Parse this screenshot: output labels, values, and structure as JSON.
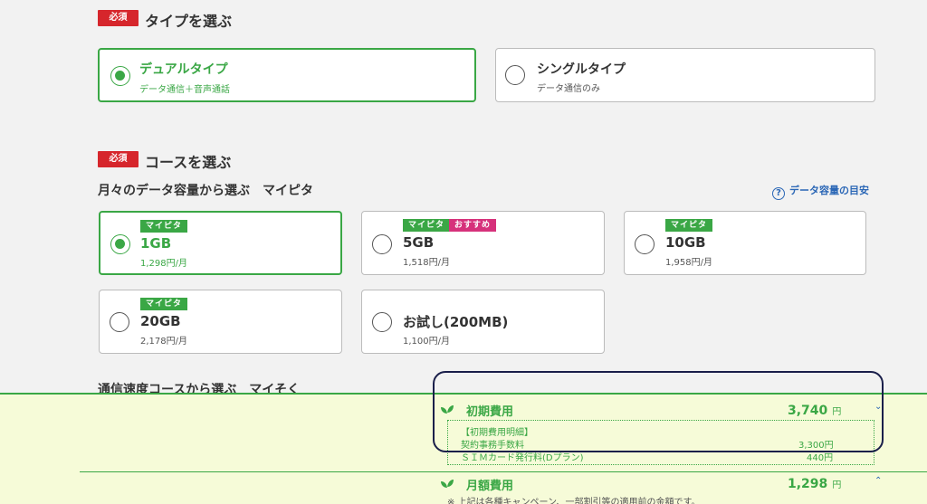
{
  "type_section": {
    "badge": "必須",
    "title": "タイプを選ぶ",
    "options": [
      {
        "name": "デュアルタイプ",
        "sub": "データ通信＋音声通話",
        "selected": true
      },
      {
        "name": "シングルタイプ",
        "sub": "データ通信のみ",
        "selected": false
      }
    ]
  },
  "course_section": {
    "badge": "必須",
    "title": "コースを選ぶ",
    "subtitle": "月々のデータ容量から選ぶ　マイピタ",
    "help_link": "データ容量の目安",
    "help_icon": "question-circle-icon",
    "options": [
      {
        "tags": [
          "マイピタ"
        ],
        "name": "1GB",
        "price": "1,298円/月",
        "selected": true
      },
      {
        "tags": [
          "マイピタ",
          "おすすめ"
        ],
        "name": "5GB",
        "price": "1,518円/月",
        "selected": false
      },
      {
        "tags": [
          "マイピタ"
        ],
        "name": "10GB",
        "price": "1,958円/月",
        "selected": false
      },
      {
        "tags": [
          "マイピタ"
        ],
        "name": "20GB",
        "price": "2,178円/月",
        "selected": false
      },
      {
        "tags": [],
        "name": "お試し(200MB)",
        "price": "1,100円/月",
        "selected": false
      }
    ],
    "speed_subtitle": "通信速度コースから選ぶ　マイそく"
  },
  "fees": {
    "initial": {
      "title": "初期費用",
      "amount": "3,740",
      "unit": "円",
      "detail_header": "【初期費用明細】",
      "items": [
        {
          "label": "契約事務手数料",
          "amount": "3,300円"
        },
        {
          "label": "ＳＩＭカード発行料(Dプラン)",
          "amount": "440円"
        }
      ]
    },
    "monthly": {
      "title": "月額費用",
      "amount": "1,298",
      "unit": "円"
    },
    "note": "※ 上記は各種キャンペーン、一部割引等の適用前の金額です。"
  },
  "colors": {
    "accent_green": "#3aa745",
    "required_red": "#d6262c",
    "link_blue": "#2b67b6",
    "panel_bg": "#f6fbd8"
  }
}
